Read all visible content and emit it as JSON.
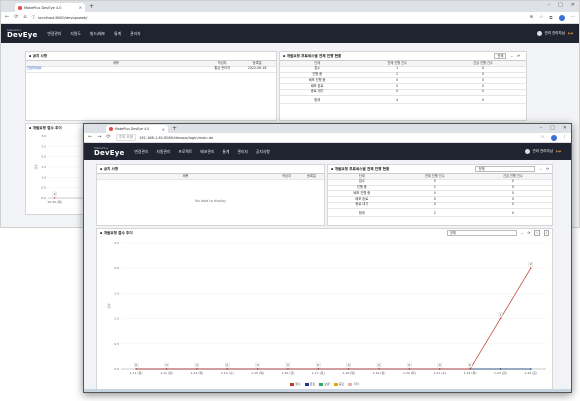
{
  "w1": {
    "tab_title": "MakePlus DevEye 4.0",
    "url": "localhost:8000/devopsweb/"
  },
  "w2": {
    "tab_title": "MakePlus DevEye 4.0",
    "security": "주의 요함",
    "url": "192.168.1.61:8000/devops/login/main.do"
  },
  "app": {
    "logo_small": "MakePlus",
    "logo": "DevEye",
    "menu": [
      "변경관리",
      "자원관리",
      "프로젝트",
      "배포관리",
      "통계",
      "관리자",
      "공지사항"
    ],
    "menu_back": [
      "변경관리",
      "자원도",
      "빌드/배포",
      "통계",
      "관리자"
    ],
    "user": "관리 관리자님"
  },
  "notice": {
    "title": "공지 사항",
    "headers": [
      "제목",
      "작성자",
      "등록일"
    ],
    "rows": [
      {
        "title": "안녕하세요",
        "author": "통상 관리자",
        "date": "2022-06-18"
      }
    ],
    "empty": "No data to display"
  },
  "status": {
    "title": "개발요청 프로세스별 전체 진행 현황",
    "filter": "전체",
    "headers": [
      "단계",
      "전체 진행 건수",
      "긴급 진행 건수"
    ],
    "rows": [
      [
        "접수",
        "1",
        "0"
      ],
      [
        "진행 중",
        "2",
        "0"
      ],
      [
        "배포 진행 중",
        "0",
        "0"
      ],
      [
        "배포 완료",
        "0",
        "0"
      ],
      [
        "종료 대기",
        "0",
        "0"
      ]
    ],
    "rows_front": [
      [
        "접수",
        "0",
        "0"
      ],
      [
        "진행 중",
        "2",
        "0"
      ],
      [
        "배포 진행 중",
        "0",
        "0"
      ],
      [
        "배포 완료",
        "0",
        "0"
      ],
      [
        "종료 대기",
        "0",
        "0"
      ]
    ],
    "total_label": "합계",
    "total": "4",
    "total_urgent": "0",
    "total_front": "2",
    "total_urgent_front": "0"
  },
  "trend": {
    "title": "개발요청 접수 추이",
    "filter": "전체",
    "ylabel": "건수"
  },
  "chart_data": [
    {
      "type": "line",
      "title": "개발요청 접수 추이",
      "ylabel": "건수",
      "x": [
        "1-11 (일)",
        "1-12 (월)",
        "1-13 (화)",
        "1-14 (수)",
        "1-15 (목)",
        "1-16 (금)",
        "1-17 (토)",
        "1-18 (일)",
        "1-19 (월)",
        "1-20 (화)",
        "1-21 (수)",
        "1-22 (목)",
        "1-23 (금)",
        "1-24 (토)"
      ],
      "ylim": [
        0,
        2.5
      ],
      "yticks": [
        "0.0",
        "0.5",
        "1.0",
        "1.5",
        "2.0",
        "2.5"
      ],
      "series": [
        {
          "name": "접수",
          "color": "#c0392b",
          "values": [
            0,
            0,
            0,
            0,
            0,
            0,
            0,
            0,
            0,
            0,
            0,
            0,
            1,
            2
          ]
        },
        {
          "name": "완료",
          "color": "#1f3a93",
          "values": [
            0,
            0,
            0,
            0,
            0,
            0,
            0,
            0,
            0,
            0,
            0,
            0,
            0,
            0
          ]
        },
        {
          "name": "보류",
          "color": "#27ae60",
          "values": [
            0,
            0,
            0,
            0,
            0,
            0,
            0,
            0,
            0,
            0,
            0,
            0,
            0,
            0
          ]
        },
        {
          "name": "중단",
          "color": "#d4ac0d",
          "values": [
            0,
            0,
            0,
            0,
            0,
            0,
            0,
            0,
            0,
            0,
            0,
            0,
            0,
            0
          ]
        },
        {
          "name": "기타",
          "color": "#e6b0aa",
          "values": [
            0,
            0,
            0,
            0,
            0,
            0,
            0,
            0,
            0,
            0,
            0,
            0,
            0,
            0
          ]
        }
      ],
      "point_labels": [
        "0",
        "0",
        "0",
        "0",
        "0",
        "0",
        "0",
        "0",
        "0",
        "0",
        "0",
        "0",
        "1",
        "2"
      ]
    },
    {
      "type": "line",
      "title": "개발요청 접수 추이",
      "ylabel": "건수",
      "x": [
        "12-30 (목)"
      ],
      "ylim": [
        0,
        3
      ],
      "yticks": [
        "0.0",
        "0.5",
        "1.0",
        "1.5",
        "2.0",
        "2.5",
        "3.0"
      ],
      "series": [
        {
          "name": "접수",
          "color": "#c0392b",
          "values": [
            0
          ]
        }
      ],
      "point_labels": [
        "0"
      ]
    }
  ]
}
